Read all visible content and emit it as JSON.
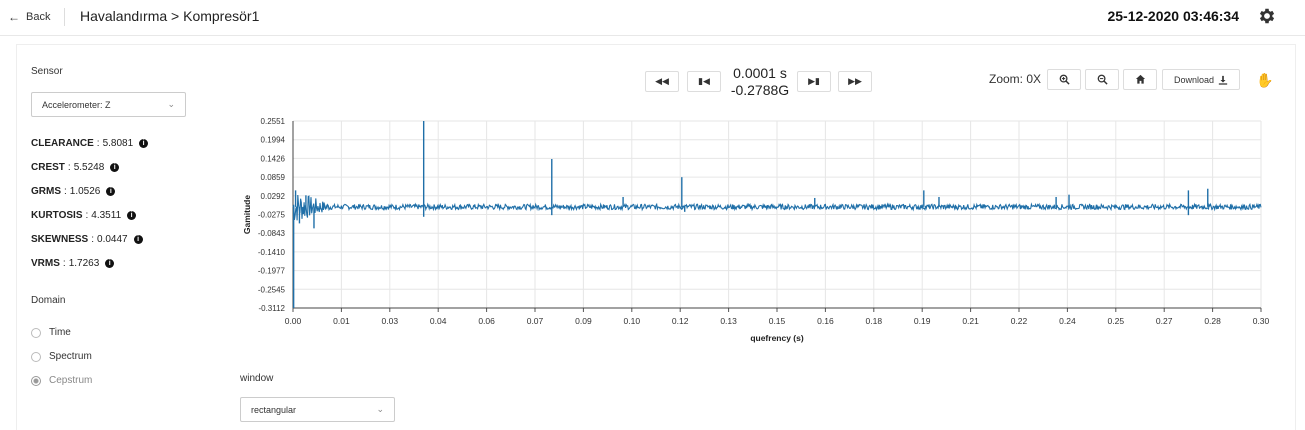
{
  "header": {
    "back_label": "Back",
    "breadcrumb": "Havalandırma > Kompresör1",
    "datetime": "25-12-2020 03:46:34"
  },
  "sensor": {
    "label": "Sensor",
    "selected": "Accelerometer: Z"
  },
  "metrics": [
    {
      "name": "CLEARANCE",
      "value": "5.8081"
    },
    {
      "name": "CREST",
      "value": "5.5248"
    },
    {
      "name": "GRMS",
      "value": "1.0526"
    },
    {
      "name": "KURTOSIS",
      "value": "4.3511"
    },
    {
      "name": "SKEWNESS",
      "value": "0.0447"
    },
    {
      "name": "VRMS",
      "value": "1.7263"
    }
  ],
  "domain": {
    "label": "Domain",
    "options": [
      "Time",
      "Spectrum",
      "Cepstrum"
    ],
    "selected": "Cepstrum"
  },
  "player": {
    "time": "0.0001 s",
    "value": "-0.2788G"
  },
  "toolbar": {
    "zoom_label": "Zoom: 0X",
    "download_label": "Download"
  },
  "window": {
    "label": "window",
    "selected": "rectangular"
  },
  "colors": {
    "series": "#1f6fa8",
    "accent": "#1e88e5"
  },
  "chart_data": {
    "type": "line",
    "xlabel": "quefrency (s)",
    "ylabel": "Gamitude",
    "xlim": [
      0.0,
      0.3
    ],
    "ylim": [
      -0.3112,
      0.2551
    ],
    "xticks": [
      "0.00",
      "0.01",
      "0.03",
      "0.04",
      "0.06",
      "0.07",
      "0.09",
      "0.10",
      "0.12",
      "0.13",
      "0.15",
      "0.16",
      "0.18",
      "0.19",
      "0.21",
      "0.22",
      "0.24",
      "0.25",
      "0.27",
      "0.28",
      "0.30"
    ],
    "yticks": [
      "0.2551",
      "0.1994",
      "0.1426",
      "0.0859",
      "0.0292",
      "-0.0275",
      "-0.0843",
      "-0.1410",
      "-0.1977",
      "-0.2545",
      "-0.3112"
    ],
    "grid": true,
    "series": [
      {
        "baseline": -0.005,
        "peaks": [
          {
            "x": 0.0002,
            "y": -0.3112
          },
          {
            "x": 0.0008,
            "y": 0.045
          },
          {
            "x": 0.002,
            "y": -0.055
          },
          {
            "x": 0.004,
            "y": 0.03
          },
          {
            "x": 0.0065,
            "y": -0.07
          },
          {
            "x": 0.0405,
            "y": 0.2551
          },
          {
            "x": 0.0405,
            "y": -0.035
          },
          {
            "x": 0.0802,
            "y": 0.14
          },
          {
            "x": 0.0802,
            "y": -0.03
          },
          {
            "x": 0.1023,
            "y": 0.025
          },
          {
            "x": 0.1205,
            "y": 0.085
          },
          {
            "x": 0.1214,
            "y": -0.02
          },
          {
            "x": 0.1617,
            "y": 0.022
          },
          {
            "x": 0.1955,
            "y": 0.045
          },
          {
            "x": 0.2002,
            "y": 0.025
          },
          {
            "x": 0.2365,
            "y": 0.025
          },
          {
            "x": 0.2405,
            "y": 0.032
          },
          {
            "x": 0.2775,
            "y": 0.045
          },
          {
            "x": 0.2775,
            "y": -0.03
          },
          {
            "x": 0.2835,
            "y": 0.05
          }
        ]
      }
    ]
  }
}
